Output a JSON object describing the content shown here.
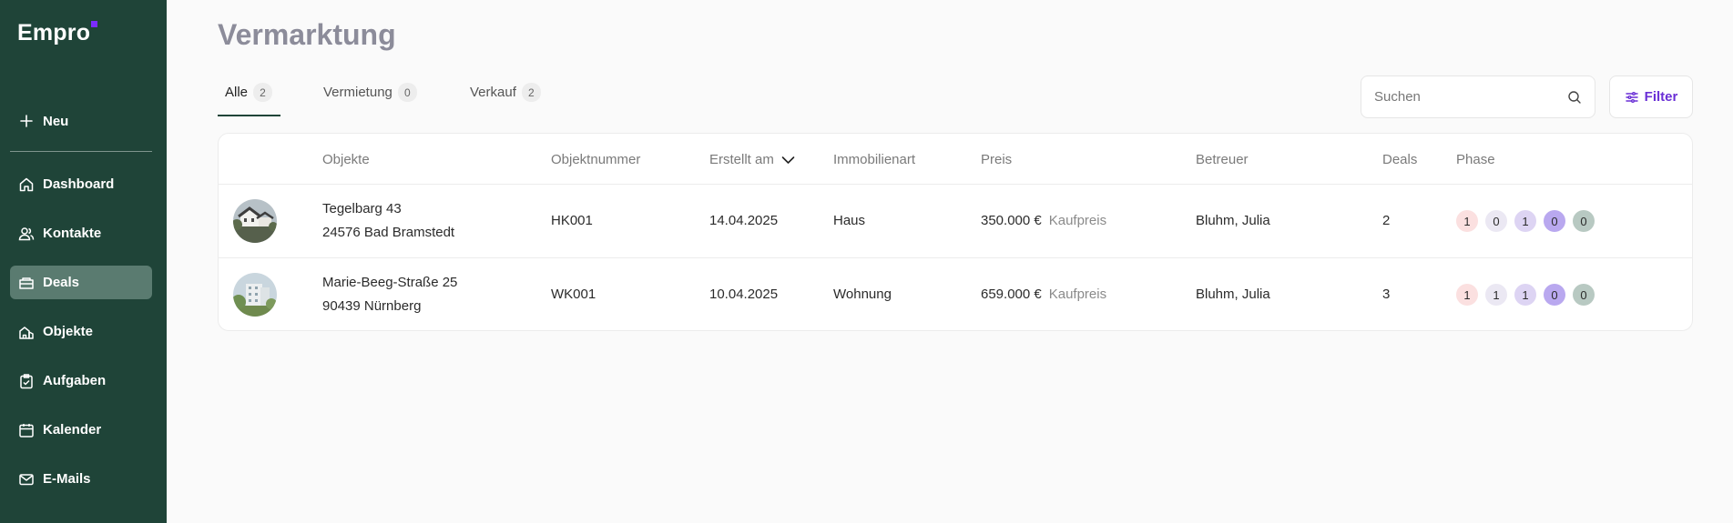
{
  "brand": {
    "name": "Empro",
    "accent": "#7b2cff"
  },
  "sidebar": {
    "new_label": "Neu",
    "items": [
      {
        "label": "Dashboard",
        "icon": "home-icon"
      },
      {
        "label": "Kontakte",
        "icon": "users-icon"
      },
      {
        "label": "Deals",
        "icon": "handshake-icon",
        "active": true
      },
      {
        "label": "Objekte",
        "icon": "buildings-icon"
      },
      {
        "label": "Aufgaben",
        "icon": "clipboard-icon"
      },
      {
        "label": "Kalender",
        "icon": "calendar-icon"
      },
      {
        "label": "E-Mails",
        "icon": "mail-icon"
      }
    ]
  },
  "page": {
    "title": "Vermarktung"
  },
  "tabs": [
    {
      "label": "Alle",
      "count": "2",
      "active": true
    },
    {
      "label": "Vermietung",
      "count": "0"
    },
    {
      "label": "Verkauf",
      "count": "2"
    }
  ],
  "search": {
    "placeholder": "Suchen"
  },
  "filter": {
    "label": "Filter"
  },
  "table": {
    "columns": [
      "Objekte",
      "Objektnummer",
      "Erstellt am",
      "Immobilienart",
      "Preis",
      "Betreuer",
      "Deals",
      "Phase"
    ],
    "rows": [
      {
        "street": "Tegelbarg 43",
        "city": "24576 Bad Bramstedt",
        "number": "HK001",
        "created": "14.04.2025",
        "type": "Haus",
        "price": "350.000 €",
        "price_type": "Kaufpreis",
        "agent": "Bluhm, Julia",
        "deals": "2",
        "phase": [
          "1",
          "0",
          "1",
          "0",
          "0"
        ]
      },
      {
        "street": "Marie-Beeg-Straße 25",
        "city": "90439 Nürnberg",
        "number": "WK001",
        "created": "10.04.2025",
        "type": "Wohnung",
        "price": "659.000 €",
        "price_type": "Kaufpreis",
        "agent": "Bluhm, Julia",
        "deals": "3",
        "phase": [
          "1",
          "1",
          "1",
          "0",
          "0"
        ]
      }
    ]
  },
  "phase_colors": [
    "#fbe0e0",
    "#ebe8f3",
    "#ddd4f3",
    "#b9a8ef",
    "#b8c9c2"
  ]
}
